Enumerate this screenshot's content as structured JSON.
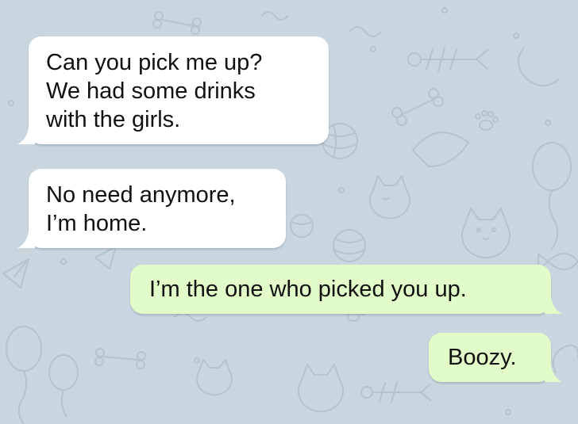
{
  "theme": {
    "wallpaper_color": "#c9d6df",
    "doodle_color": "#b4c3cd",
    "incoming_bubble_color": "#ffffff",
    "outgoing_bubble_color": "#e1fbc9",
    "text_color": "#111111"
  },
  "messages": [
    {
      "direction": "incoming",
      "lines": [
        "Can you pick me up?",
        "We had some drinks",
        "with the girls."
      ]
    },
    {
      "direction": "incoming",
      "lines": [
        "No need anymore,",
        "I’m home."
      ]
    },
    {
      "direction": "outgoing",
      "lines": [
        "I’m the one who picked you up."
      ]
    },
    {
      "direction": "outgoing",
      "lines": [
        "Boozy."
      ]
    }
  ],
  "wallpaper_icons": [
    "cat-icon",
    "balloon-icon",
    "fish-bone-icon",
    "bone-icon",
    "paw-icon",
    "ball-icon",
    "paper-plane-icon",
    "fish-icon"
  ]
}
